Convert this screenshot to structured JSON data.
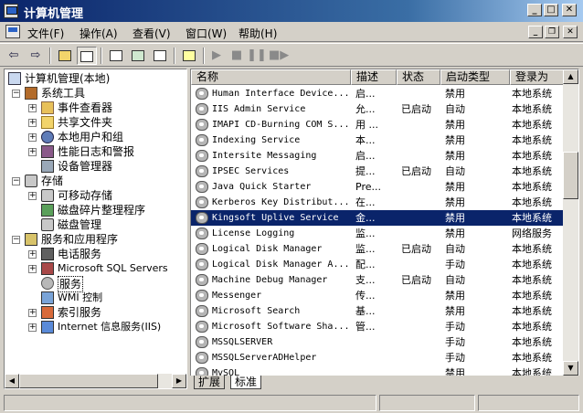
{
  "window": {
    "title": "计算机管理"
  },
  "menu": {
    "items": [
      "文件(F)",
      "操作(A)",
      "查看(V)",
      "窗口(W)",
      "帮助(H)"
    ]
  },
  "tree": {
    "items": [
      {
        "label": "计算机管理(本地)",
        "icon": "computer-icon"
      },
      {
        "label": "系统工具",
        "icon": "tools-icon"
      },
      {
        "label": "事件查看器",
        "icon": "event-viewer-icon"
      },
      {
        "label": "共享文件夹",
        "icon": "shared-folder-icon"
      },
      {
        "label": "本地用户和组",
        "icon": "users-icon"
      },
      {
        "label": "性能日志和警报",
        "icon": "performance-icon"
      },
      {
        "label": "设备管理器",
        "icon": "device-manager-icon"
      },
      {
        "label": "存储",
        "icon": "storage-icon"
      },
      {
        "label": "可移动存储",
        "icon": "removable-storage-icon"
      },
      {
        "label": "磁盘碎片整理程序",
        "icon": "defrag-icon"
      },
      {
        "label": "磁盘管理",
        "icon": "disk-management-icon"
      },
      {
        "label": "服务和应用程序",
        "icon": "services-apps-icon"
      },
      {
        "label": "电话服务",
        "icon": "telephony-icon"
      },
      {
        "label": "Microsoft SQL Servers",
        "icon": "sql-server-icon"
      },
      {
        "label": "服务",
        "icon": "services-icon"
      },
      {
        "label": "WMI 控制",
        "icon": "wmi-icon"
      },
      {
        "label": "索引服务",
        "icon": "indexing-icon"
      },
      {
        "label": "Internet 信息服务(IIS)",
        "icon": "iis-icon"
      }
    ]
  },
  "list": {
    "columns": [
      "名称",
      "描述",
      "状态",
      "启动类型",
      "登录为"
    ],
    "rows": [
      {
        "name": "Human Interface Device...",
        "desc": "启...",
        "status": "",
        "startup": "禁用",
        "logon": "本地系统"
      },
      {
        "name": "IIS Admin Service",
        "desc": "允...",
        "status": "已启动",
        "startup": "自动",
        "logon": "本地系统"
      },
      {
        "name": "IMAPI CD-Burning COM S...",
        "desc": "用 ...",
        "status": "",
        "startup": "禁用",
        "logon": "本地系统"
      },
      {
        "name": "Indexing Service",
        "desc": "本...",
        "status": "",
        "startup": "禁用",
        "logon": "本地系统"
      },
      {
        "name": "Intersite Messaging",
        "desc": "启...",
        "status": "",
        "startup": "禁用",
        "logon": "本地系统"
      },
      {
        "name": "IPSEC Services",
        "desc": "提...",
        "status": "已启动",
        "startup": "自动",
        "logon": "本地系统"
      },
      {
        "name": "Java Quick Starter",
        "desc": "Pre...",
        "status": "",
        "startup": "禁用",
        "logon": "本地系统"
      },
      {
        "name": "Kerberos Key Distribut...",
        "desc": "在...",
        "status": "",
        "startup": "禁用",
        "logon": "本地系统"
      },
      {
        "name": "Kingsoft Uplive Service",
        "desc": "金...",
        "status": "",
        "startup": "禁用",
        "logon": "本地系统"
      },
      {
        "name": "License Logging",
        "desc": "监...",
        "status": "",
        "startup": "禁用",
        "logon": "网络服务"
      },
      {
        "name": "Logical Disk Manager",
        "desc": "监...",
        "status": "已启动",
        "startup": "自动",
        "logon": "本地系统"
      },
      {
        "name": "Logical Disk Manager A...",
        "desc": "配...",
        "status": "",
        "startup": "手动",
        "logon": "本地系统"
      },
      {
        "name": "Machine Debug Manager",
        "desc": "支...",
        "status": "已启动",
        "startup": "自动",
        "logon": "本地系统"
      },
      {
        "name": "Messenger",
        "desc": "传...",
        "status": "",
        "startup": "禁用",
        "logon": "本地系统"
      },
      {
        "name": "Microsoft Search",
        "desc": "基...",
        "status": "",
        "startup": "禁用",
        "logon": "本地系统"
      },
      {
        "name": "Microsoft Software Sha...",
        "desc": "管...",
        "status": "",
        "startup": "手动",
        "logon": "本地系统"
      },
      {
        "name": "MSSQLSERVER",
        "desc": "",
        "status": "",
        "startup": "手动",
        "logon": "本地系统"
      },
      {
        "name": "MSSQLServerADHelper",
        "desc": "",
        "status": "",
        "startup": "手动",
        "logon": "本地系统"
      },
      {
        "name": "MySQL",
        "desc": "",
        "status": "",
        "startup": "禁用",
        "logon": "本地系统"
      }
    ]
  },
  "tabs": [
    "扩展",
    "标准"
  ]
}
